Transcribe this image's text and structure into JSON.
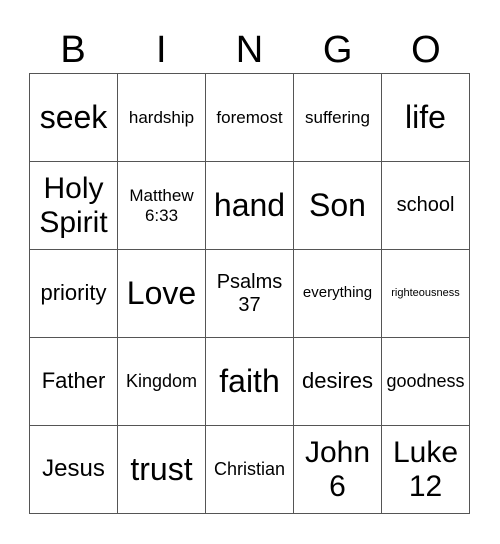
{
  "header": {
    "letters": [
      "B",
      "I",
      "N",
      "G",
      "O"
    ]
  },
  "card": {
    "rows": [
      [
        "seek",
        "hardship",
        "foremost",
        "suffering",
        "life"
      ],
      [
        "Holy\nSpirit",
        "Matthew\n6:33",
        "hand",
        "Son",
        "school"
      ],
      [
        "priority",
        "Love",
        "Psalms\n37",
        "everything",
        "righteousness"
      ],
      [
        "Father",
        "Kingdom",
        "faith",
        "desires",
        "goodness"
      ],
      [
        "Jesus",
        "trust",
        "Christian",
        "John\n6",
        "Luke\n12"
      ]
    ]
  },
  "colors": {
    "grid_line": "#555555",
    "text": "#000000",
    "background": "#ffffff"
  }
}
